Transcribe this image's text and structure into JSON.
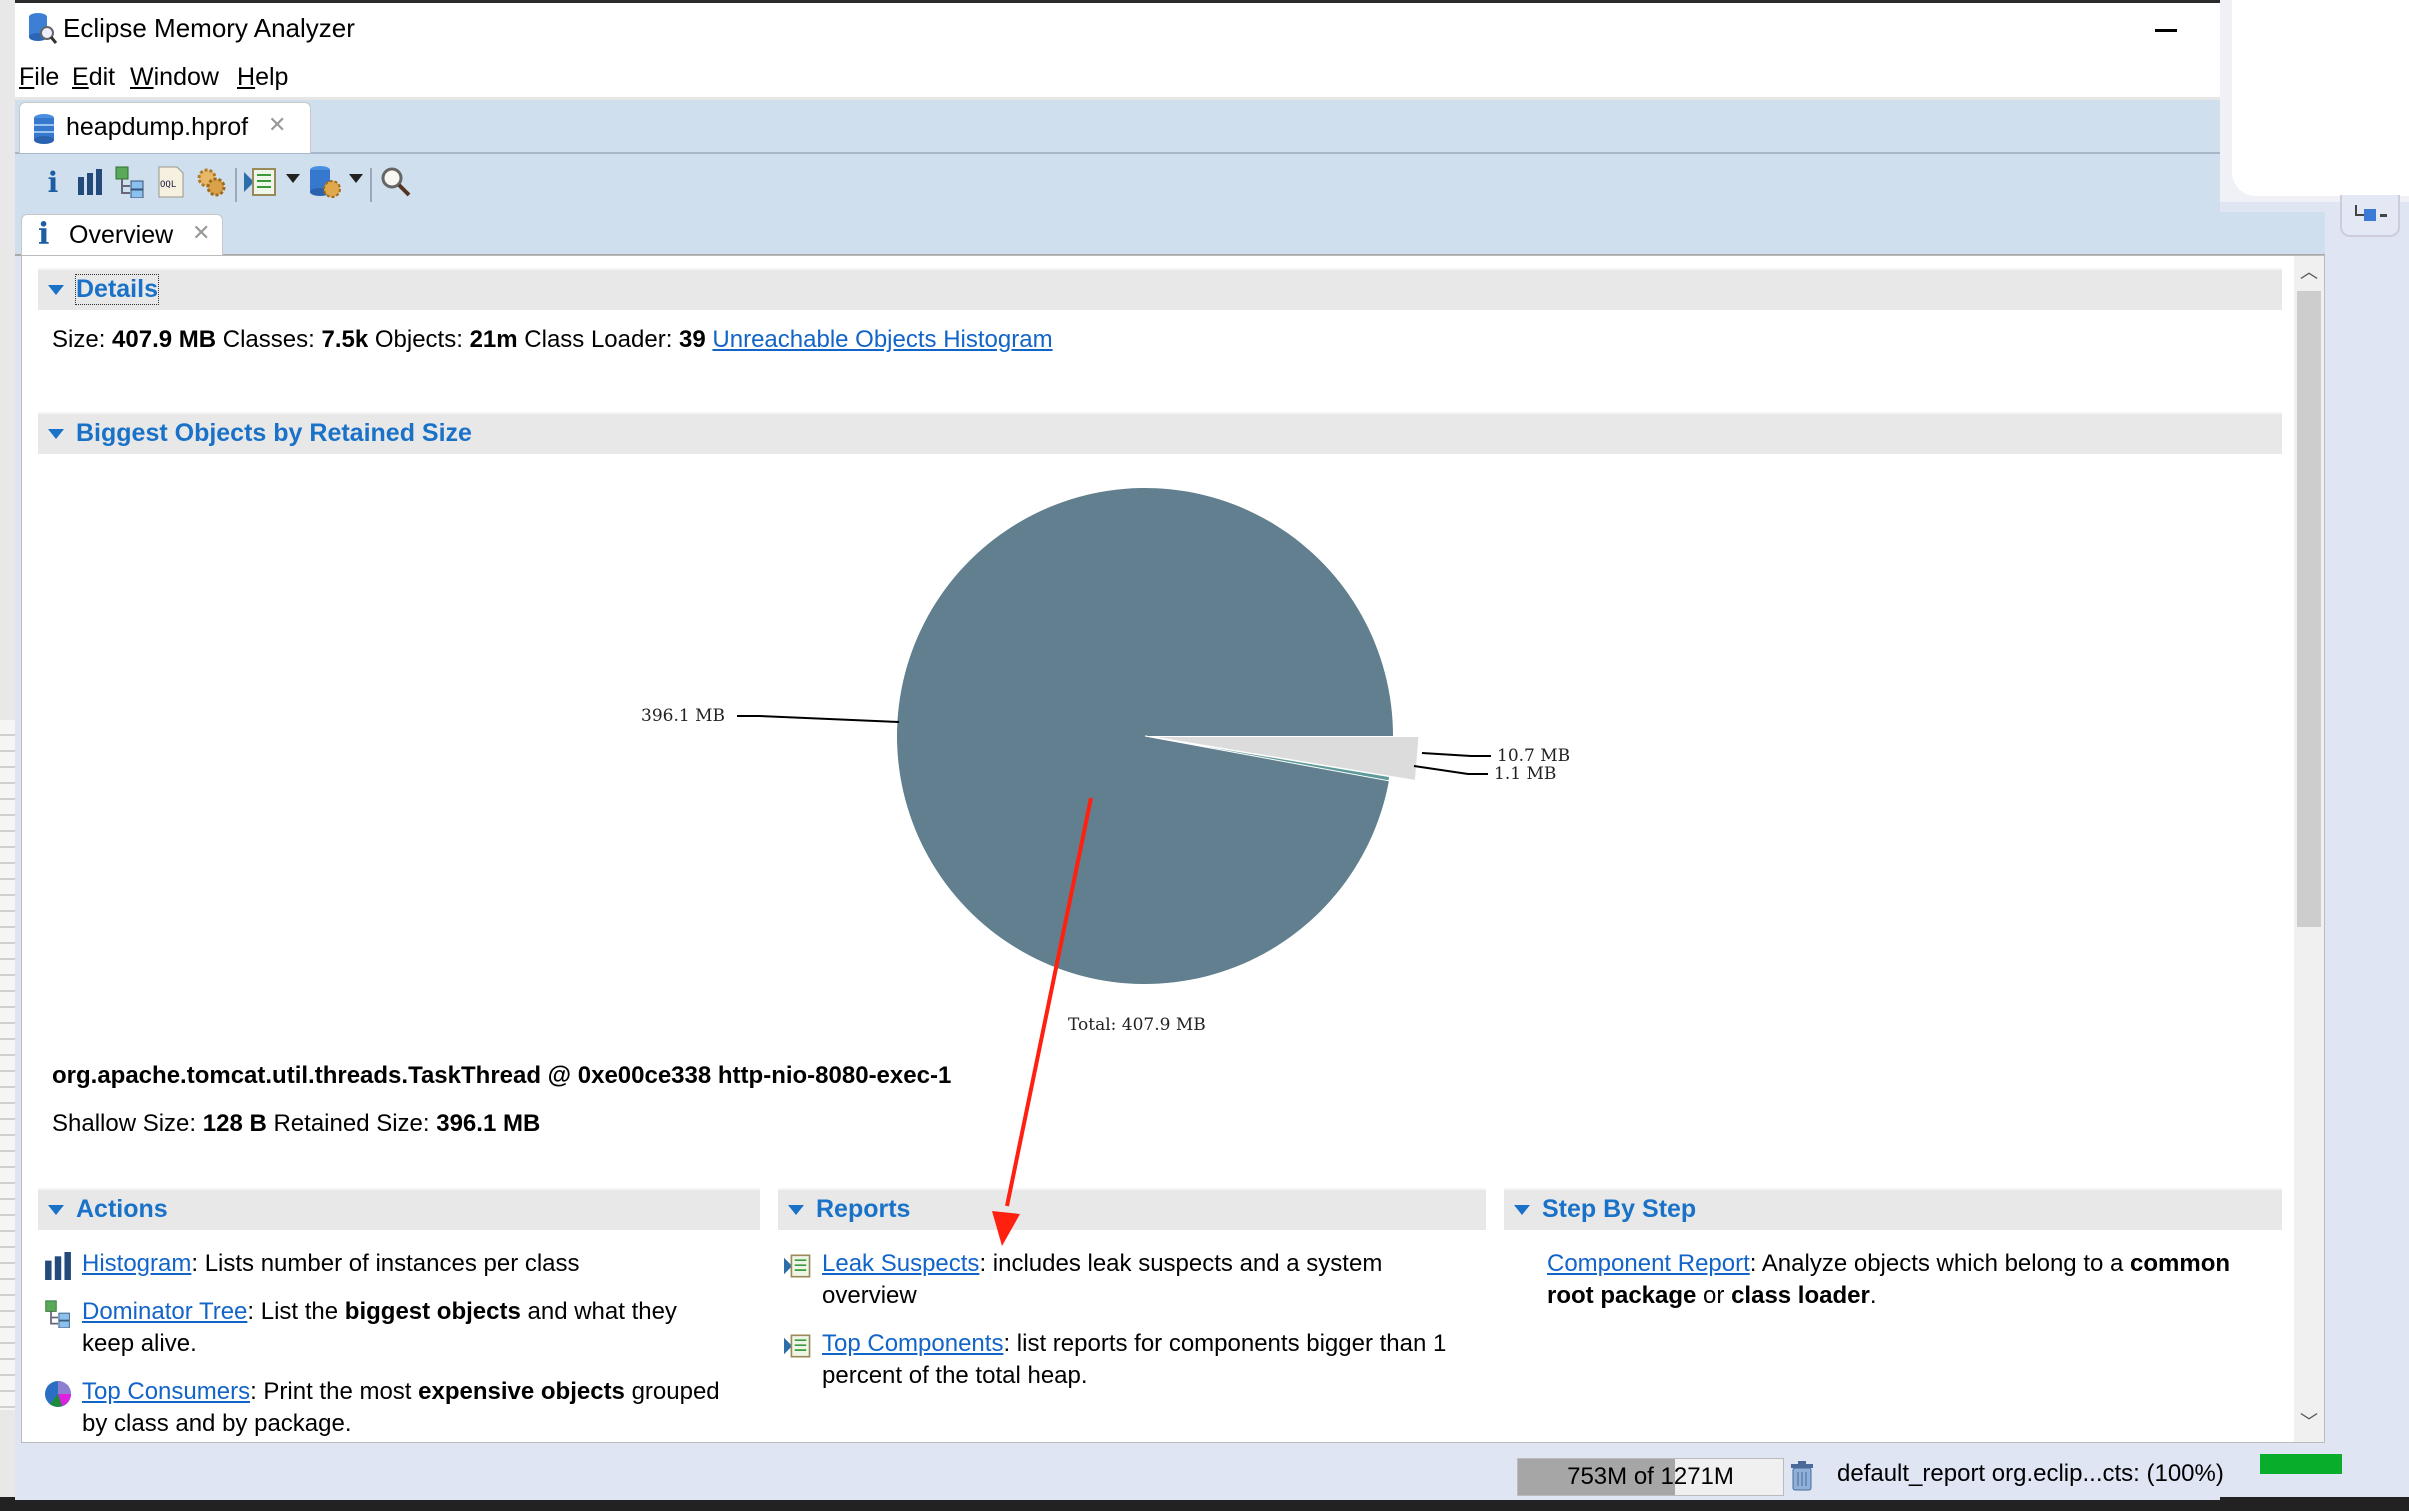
{
  "window": {
    "title": "Eclipse Memory Analyzer",
    "menu": [
      {
        "label": "File",
        "mnemonic": "F",
        "rest": "ile"
      },
      {
        "label": "Edit",
        "mnemonic": "E",
        "rest": "dit"
      },
      {
        "label": "Window",
        "mnemonic": "W",
        "rest": "indow"
      },
      {
        "label": "Help",
        "mnemonic": "H",
        "rest": "elp"
      }
    ]
  },
  "editor_tab": {
    "label": "heapdump.hprof"
  },
  "toolbar": {
    "items": [
      "overview-icon",
      "histogram-icon",
      "dominator-tree-icon",
      "oql-icon",
      "heap-dump-details-icon",
      "run-report-icon",
      "query-browser-icon",
      "search-icon"
    ]
  },
  "view_tab": {
    "label": "Overview"
  },
  "details": {
    "header": "Details",
    "size_label": "Size:",
    "size_value": "407.9 MB",
    "classes_label": "Classes:",
    "classes_value": "7.5k",
    "objects_label": "Objects:",
    "objects_value": "21m",
    "loader_label": "Class Loader:",
    "loader_value": "39",
    "unreachable_link": "Unreachable Objects Histogram"
  },
  "biggest": {
    "header": "Biggest Objects by Retained Size",
    "object_name": "org.apache.tomcat.util.threads.TaskThread @ 0xe00ce338 http-nio-8080-exec-1",
    "shallow_label": "Shallow Size:",
    "shallow_value": "128 B",
    "retained_label": "Retained Size:",
    "retained_value": "396.1 MB"
  },
  "chart_data": {
    "type": "pie",
    "title": "Biggest Objects by Retained Size",
    "unit": "MB",
    "slices": [
      {
        "label": "396.1 MB",
        "value": 396.1,
        "color": "#617f8e",
        "exploded": false
      },
      {
        "label": "10.7 MB",
        "value": 10.7,
        "color": "#dcdcdc",
        "exploded": true
      },
      {
        "label": "1.1 MB",
        "value": 1.1,
        "color": "#5f9a9a",
        "exploded": false
      }
    ],
    "total_label": "Total: 407.9 MB",
    "total": 407.9
  },
  "annotation": {
    "type": "arrow",
    "color": "#ff2010"
  },
  "actions": {
    "header": "Actions",
    "items": [
      {
        "link": "Histogram",
        "text": ": Lists number of instances per class"
      },
      {
        "link": "Dominator Tree",
        "pre": ": List the ",
        "bold": "biggest objects",
        "post": " and what they keep alive."
      },
      {
        "link": "Top Consumers",
        "pre": ": Print the most ",
        "bold": "expensive objects",
        "post": " grouped by class and by package."
      }
    ]
  },
  "reports": {
    "header": "Reports",
    "items": [
      {
        "link": "Leak Suspects",
        "text": ": includes leak suspects and a system overview"
      },
      {
        "link": "Top Components",
        "text": ": list reports for components bigger than 1 percent of the total heap."
      }
    ]
  },
  "step_by_step": {
    "header": "Step By Step",
    "items": [
      {
        "link": "Component Report",
        "pre": ": Analyze objects which belong to a ",
        "bold1": "common root package",
        "mid": " or ",
        "bold2": "class loader",
        "post": "."
      }
    ]
  },
  "status": {
    "heap_text": "753M of 1271M",
    "heap_used_mb": 753,
    "heap_total_mb": 1271,
    "job_text": "default_report  org.eclip...cts: (100%)",
    "job_progress_percent": 100,
    "progress_color": "#09ad2c"
  }
}
